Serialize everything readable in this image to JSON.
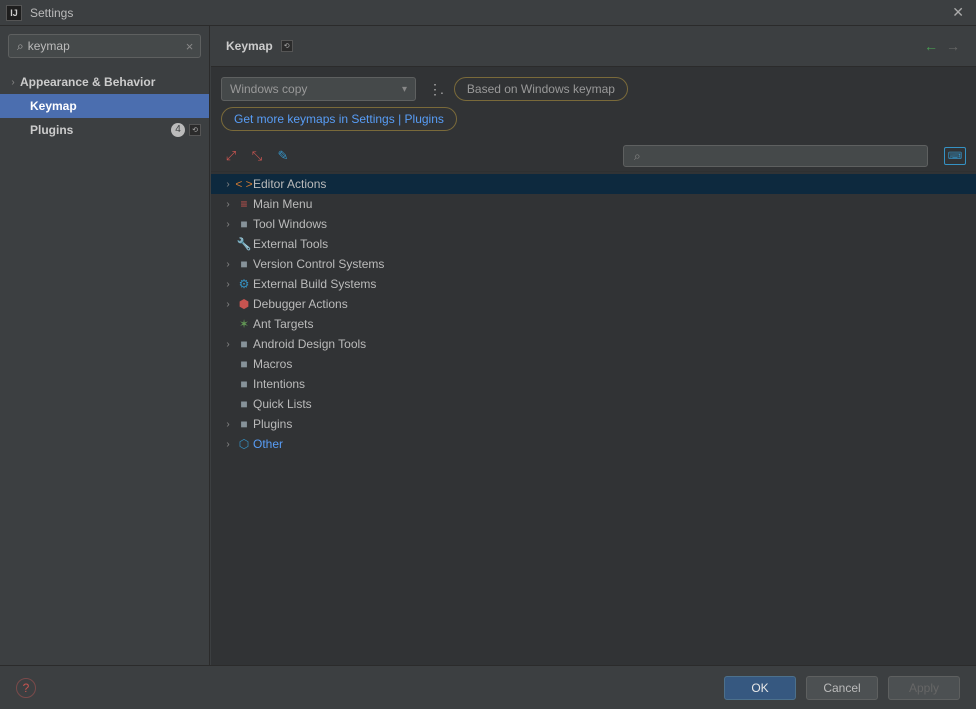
{
  "window": {
    "title": "Settings"
  },
  "sidebar": {
    "search_value": "keymap",
    "items": [
      {
        "label": "Appearance & Behavior",
        "expandable": true,
        "bold": true,
        "selected": false,
        "indent": 0
      },
      {
        "label": "Keymap",
        "expandable": false,
        "bold": true,
        "selected": true,
        "indent": 1
      },
      {
        "label": "Plugins",
        "expandable": false,
        "bold": true,
        "selected": false,
        "indent": 1,
        "badge": "4",
        "mini": true
      }
    ]
  },
  "breadcrumb": {
    "title": "Keymap"
  },
  "panel": {
    "scheme_selected": "Windows copy",
    "based_on": "Based on Windows keymap",
    "more_link": "Get more keymaps in Settings | Plugins",
    "action_search": ""
  },
  "tree": [
    {
      "label": "Editor Actions",
      "icon": "code",
      "iconClass": "code-icon",
      "glyph": "< >",
      "hasChildren": true,
      "selected": true
    },
    {
      "label": "Main Menu",
      "icon": "menu",
      "iconClass": "menu-icon",
      "glyph": "≡",
      "hasChildren": true,
      "selected": false
    },
    {
      "label": "Tool Windows",
      "icon": "folder",
      "iconClass": "folder-icon",
      "glyph": "■",
      "hasChildren": true,
      "selected": false
    },
    {
      "label": "External Tools",
      "icon": "wrench",
      "iconClass": "wrench-icon",
      "glyph": "🔧",
      "hasChildren": false,
      "selected": false
    },
    {
      "label": "Version Control Systems",
      "icon": "folder",
      "iconClass": "folder-icon",
      "glyph": "■",
      "hasChildren": true,
      "selected": false
    },
    {
      "label": "External Build Systems",
      "icon": "gear",
      "iconClass": "gear2-icon",
      "glyph": "⚙",
      "hasChildren": true,
      "selected": false
    },
    {
      "label": "Debugger Actions",
      "icon": "bug",
      "iconClass": "bug-icon",
      "glyph": "⬢",
      "hasChildren": true,
      "selected": false
    },
    {
      "label": "Ant Targets",
      "icon": "ant",
      "iconClass": "ant-icon",
      "glyph": "✶",
      "hasChildren": false,
      "selected": false
    },
    {
      "label": "Android Design Tools",
      "icon": "folder",
      "iconClass": "folder-icon",
      "glyph": "■",
      "hasChildren": true,
      "selected": false
    },
    {
      "label": "Macros",
      "icon": "folder",
      "iconClass": "folder-icon",
      "glyph": "■",
      "hasChildren": false,
      "selected": false
    },
    {
      "label": "Intentions",
      "icon": "folder",
      "iconClass": "folder-icon",
      "glyph": "■",
      "hasChildren": false,
      "selected": false
    },
    {
      "label": "Quick Lists",
      "icon": "folder",
      "iconClass": "folder-icon",
      "glyph": "■",
      "hasChildren": false,
      "selected": false
    },
    {
      "label": "Plugins",
      "icon": "folder",
      "iconClass": "folder-icon",
      "glyph": "■",
      "hasChildren": true,
      "selected": false
    },
    {
      "label": "Other",
      "icon": "basket",
      "iconClass": "basket-icon",
      "glyph": "⬡",
      "hasChildren": true,
      "selected": false,
      "linkish": true
    }
  ],
  "footer": {
    "ok": "OK",
    "cancel": "Cancel",
    "apply": "Apply"
  }
}
